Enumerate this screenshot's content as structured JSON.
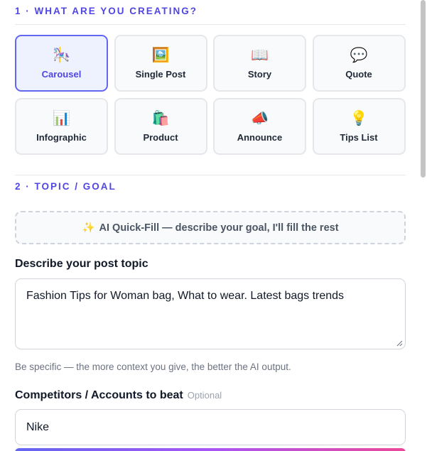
{
  "sections": {
    "creating_title": "1 · WHAT ARE YOU CREATING?",
    "topic_title": "2 · TOPIC / GOAL"
  },
  "post_types": [
    {
      "label": "Carousel",
      "emoji": "🎠",
      "icon": "carousel-icon",
      "selected": true
    },
    {
      "label": "Single Post",
      "emoji": "🖼️",
      "icon": "framed-picture-icon",
      "selected": false
    },
    {
      "label": "Story",
      "emoji": "📖",
      "icon": "open-book-icon",
      "selected": false
    },
    {
      "label": "Quote",
      "emoji": "💬",
      "icon": "speech-bubble-icon",
      "selected": false
    },
    {
      "label": "Infographic",
      "emoji": "📊",
      "icon": "bar-chart-icon",
      "selected": false
    },
    {
      "label": "Product",
      "emoji": "🛍️",
      "icon": "shopping-bags-icon",
      "selected": false
    },
    {
      "label": "Announce",
      "emoji": "📣",
      "icon": "megaphone-icon",
      "selected": false
    },
    {
      "label": "Tips List",
      "emoji": "💡",
      "icon": "light-bulb-icon",
      "selected": false
    }
  ],
  "quickfill": {
    "sparkle": "✨",
    "label": "AI Quick-Fill — describe your goal, I'll fill the rest"
  },
  "topic": {
    "label": "Describe your post topic",
    "value": "Fashion Tips for Woman bag, What to wear. Latest bags trends",
    "hint": "Be specific — the more context you give, the better the AI output."
  },
  "competitors": {
    "label": "Competitors / Accounts to beat",
    "optional": "Optional",
    "value": "Nike"
  },
  "colors": {
    "accent": "#4f46e5",
    "selected_border": "#6366f1",
    "selected_bg": "#eef2ff"
  }
}
